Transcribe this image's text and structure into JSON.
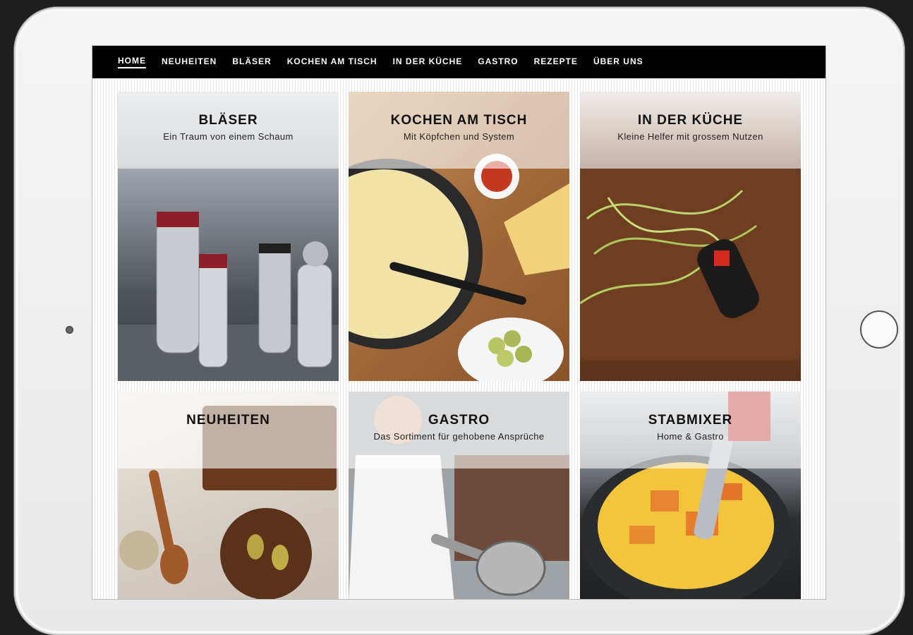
{
  "nav": {
    "items": [
      {
        "label": "HOME",
        "active": true
      },
      {
        "label": "NEUHEITEN"
      },
      {
        "label": "BLÄSER"
      },
      {
        "label": "KOCHEN AM TISCH"
      },
      {
        "label": "IN DER KÜCHE"
      },
      {
        "label": "GASTRO"
      },
      {
        "label": "REZEPTE"
      },
      {
        "label": "ÜBER UNS"
      }
    ]
  },
  "tiles": [
    {
      "title": "BLÄSER",
      "subtitle": "Ein Traum von einem Schaum"
    },
    {
      "title": "KOCHEN AM TISCH",
      "subtitle": "Mit Köpfchen und System"
    },
    {
      "title": "IN DER KÜCHE",
      "subtitle": "Kleine Helfer mit grossem Nutzen"
    },
    {
      "title": "NEUHEITEN",
      "subtitle": ""
    },
    {
      "title": "GASTRO",
      "subtitle": "Das Sortiment für gehobene Ansprüche"
    },
    {
      "title": "STABMIXER",
      "subtitle": "Home & Gastro"
    }
  ],
  "colors": {
    "nav_bg": "#000000",
    "nav_text": "#ffffff",
    "tile_overlay": "rgba(255,255,255,0.6)",
    "swiss_red": "#d52b1e"
  },
  "icons": {
    "camera": "front-camera-icon",
    "home_button": "home-button-icon"
  }
}
